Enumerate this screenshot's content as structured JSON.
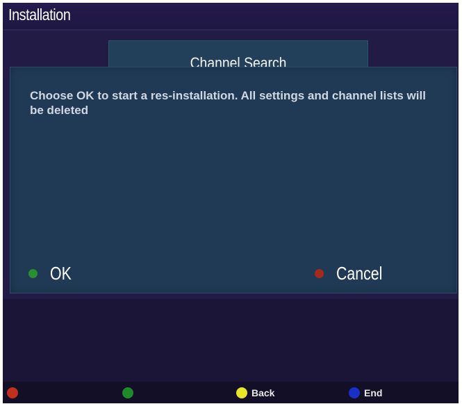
{
  "header": {
    "title": "Installation"
  },
  "menu": {
    "tab_label": "Channel Search"
  },
  "dialog": {
    "message": "Choose OK to start a res-installation. All settings and channel lists will be deleted",
    "ok_label": "OK",
    "cancel_label": "Cancel"
  },
  "footer": {
    "items": [
      {
        "color": "#c0301c",
        "label": ""
      },
      {
        "color": "#1f8a2a",
        "label": ""
      },
      {
        "color": "#e6e62a",
        "label": "Back"
      },
      {
        "color": "#1a2ec8",
        "label": "End"
      }
    ]
  },
  "colors": {
    "ok_dot": "#2a8f2f",
    "cancel_dot": "#a52a1a",
    "background": "#1b1638",
    "dialog": "#203a56"
  }
}
